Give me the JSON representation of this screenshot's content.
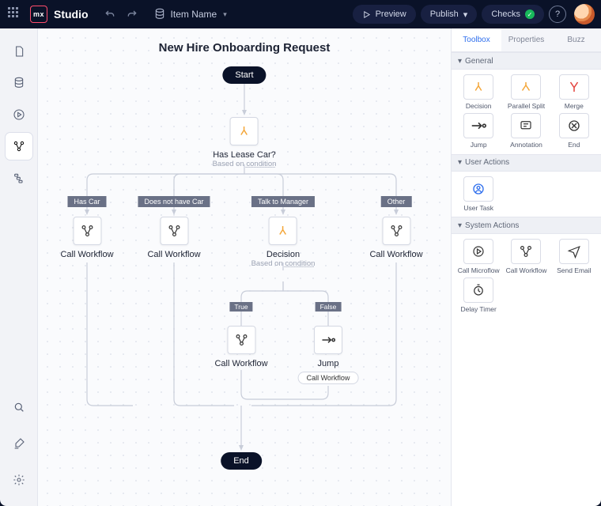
{
  "header": {
    "logo_text": "mx",
    "brand": "Studio",
    "item_label": "Item Name",
    "preview": "Preview",
    "publish": "Publish",
    "checks": "Checks"
  },
  "canvas": {
    "title": "New Hire Onboarding Request",
    "start": "Start",
    "end": "End",
    "decision1_name": "Has Lease Car?",
    "decision1_sub_a": "Based on ",
    "decision1_sub_b": "condition",
    "branches": {
      "has_car": "Has Car",
      "no_car": "Does not have Car",
      "talk": "Talk to Manager",
      "other": "Other"
    },
    "call_workflow": "Call Workflow",
    "decision2_name": "Decision",
    "decision2_sub_a": "Based on ",
    "decision2_sub_b": "condition",
    "truefalse": {
      "t": "True",
      "f": "False"
    },
    "jump": "Jump",
    "jump_target": "Call Workflow"
  },
  "rpanel": {
    "tabs": {
      "toolbox": "Toolbox",
      "properties": "Properties",
      "buzz": "Buzz"
    },
    "sections": {
      "general": "General",
      "user_actions": "User Actions",
      "system_actions": "System Actions"
    },
    "tools": {
      "decision": "Decision",
      "parallel_split": "Parallel Split",
      "merge": "Merge",
      "jump": "Jump",
      "annotation": "Annotation",
      "end": "End",
      "user_task": "User Task",
      "call_microflow": "Call Microflow",
      "call_workflow": "Call Workflow",
      "send_email": "Send Email",
      "delay_timer": "Delay Timer"
    }
  }
}
